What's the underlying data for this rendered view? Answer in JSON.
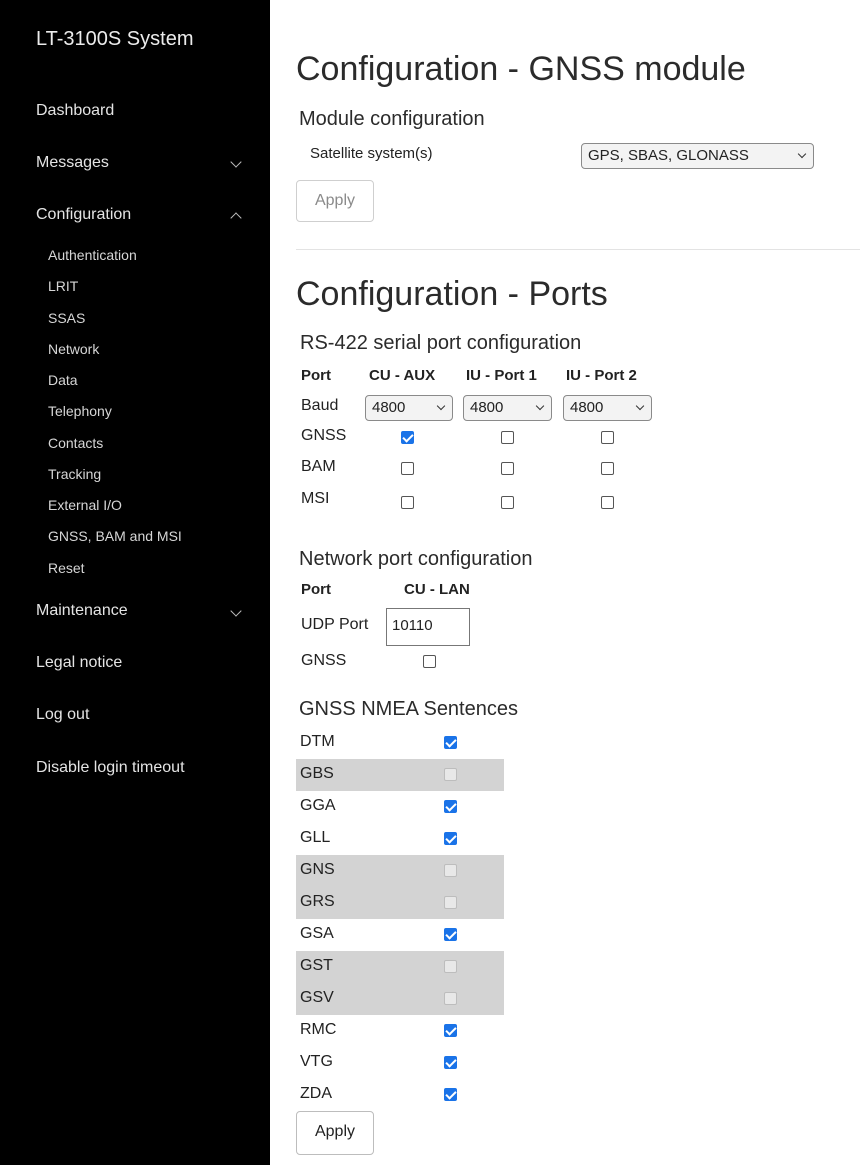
{
  "sidebar": {
    "title": "LT-3100S System",
    "items": [
      {
        "label": "Dashboard"
      },
      {
        "label": "Messages"
      },
      {
        "label": "Configuration"
      },
      {
        "label": "Maintenance"
      },
      {
        "label": "Legal notice"
      },
      {
        "label": "Log out"
      },
      {
        "label": "Disable login timeout"
      }
    ],
    "config_subitems": [
      {
        "label": "Authentication"
      },
      {
        "label": "LRIT"
      },
      {
        "label": "SSAS"
      },
      {
        "label": "Network"
      },
      {
        "label": "Data"
      },
      {
        "label": "Telephony"
      },
      {
        "label": "Contacts"
      },
      {
        "label": "Tracking"
      },
      {
        "label": "External I/O"
      },
      {
        "label": "GNSS, BAM and MSI"
      },
      {
        "label": "Reset"
      }
    ]
  },
  "gnss_module": {
    "title": "Configuration - GNSS module",
    "section": "Module configuration",
    "satellite_label": "Satellite system(s)",
    "satellite_value": "GPS, SBAS, GLONASS",
    "apply_label": "Apply"
  },
  "ports": {
    "title": "Configuration - Ports",
    "rs422": {
      "section": "RS-422 serial port configuration",
      "port_header": "Port",
      "columns": [
        "CU - AUX",
        "IU - Port 1",
        "IU - Port 2"
      ],
      "baud_label": "Baud",
      "baud_values": [
        "4800",
        "4800",
        "4800"
      ],
      "rows": [
        {
          "label": "GNSS",
          "checked": [
            true,
            false,
            false
          ]
        },
        {
          "label": "BAM",
          "checked": [
            false,
            false,
            false
          ]
        },
        {
          "label": "MSI",
          "checked": [
            false,
            false,
            false
          ]
        }
      ]
    },
    "network": {
      "section": "Network port configuration",
      "port_header": "Port",
      "column": "CU - LAN",
      "udp_label": "UDP Port",
      "udp_value": "10110",
      "gnss_label": "GNSS",
      "gnss_checked": false
    },
    "nmea": {
      "section": "GNSS NMEA Sentences",
      "sentences": [
        {
          "name": "DTM",
          "checked": true,
          "enabled": true
        },
        {
          "name": "GBS",
          "checked": false,
          "enabled": false
        },
        {
          "name": "GGA",
          "checked": true,
          "enabled": true
        },
        {
          "name": "GLL",
          "checked": true,
          "enabled": true
        },
        {
          "name": "GNS",
          "checked": false,
          "enabled": false
        },
        {
          "name": "GRS",
          "checked": false,
          "enabled": false
        },
        {
          "name": "GSA",
          "checked": true,
          "enabled": true
        },
        {
          "name": "GST",
          "checked": false,
          "enabled": false
        },
        {
          "name": "GSV",
          "checked": false,
          "enabled": false
        },
        {
          "name": "RMC",
          "checked": true,
          "enabled": true
        },
        {
          "name": "VTG",
          "checked": true,
          "enabled": true
        },
        {
          "name": "ZDA",
          "checked": true,
          "enabled": true
        }
      ]
    },
    "apply_label": "Apply"
  }
}
